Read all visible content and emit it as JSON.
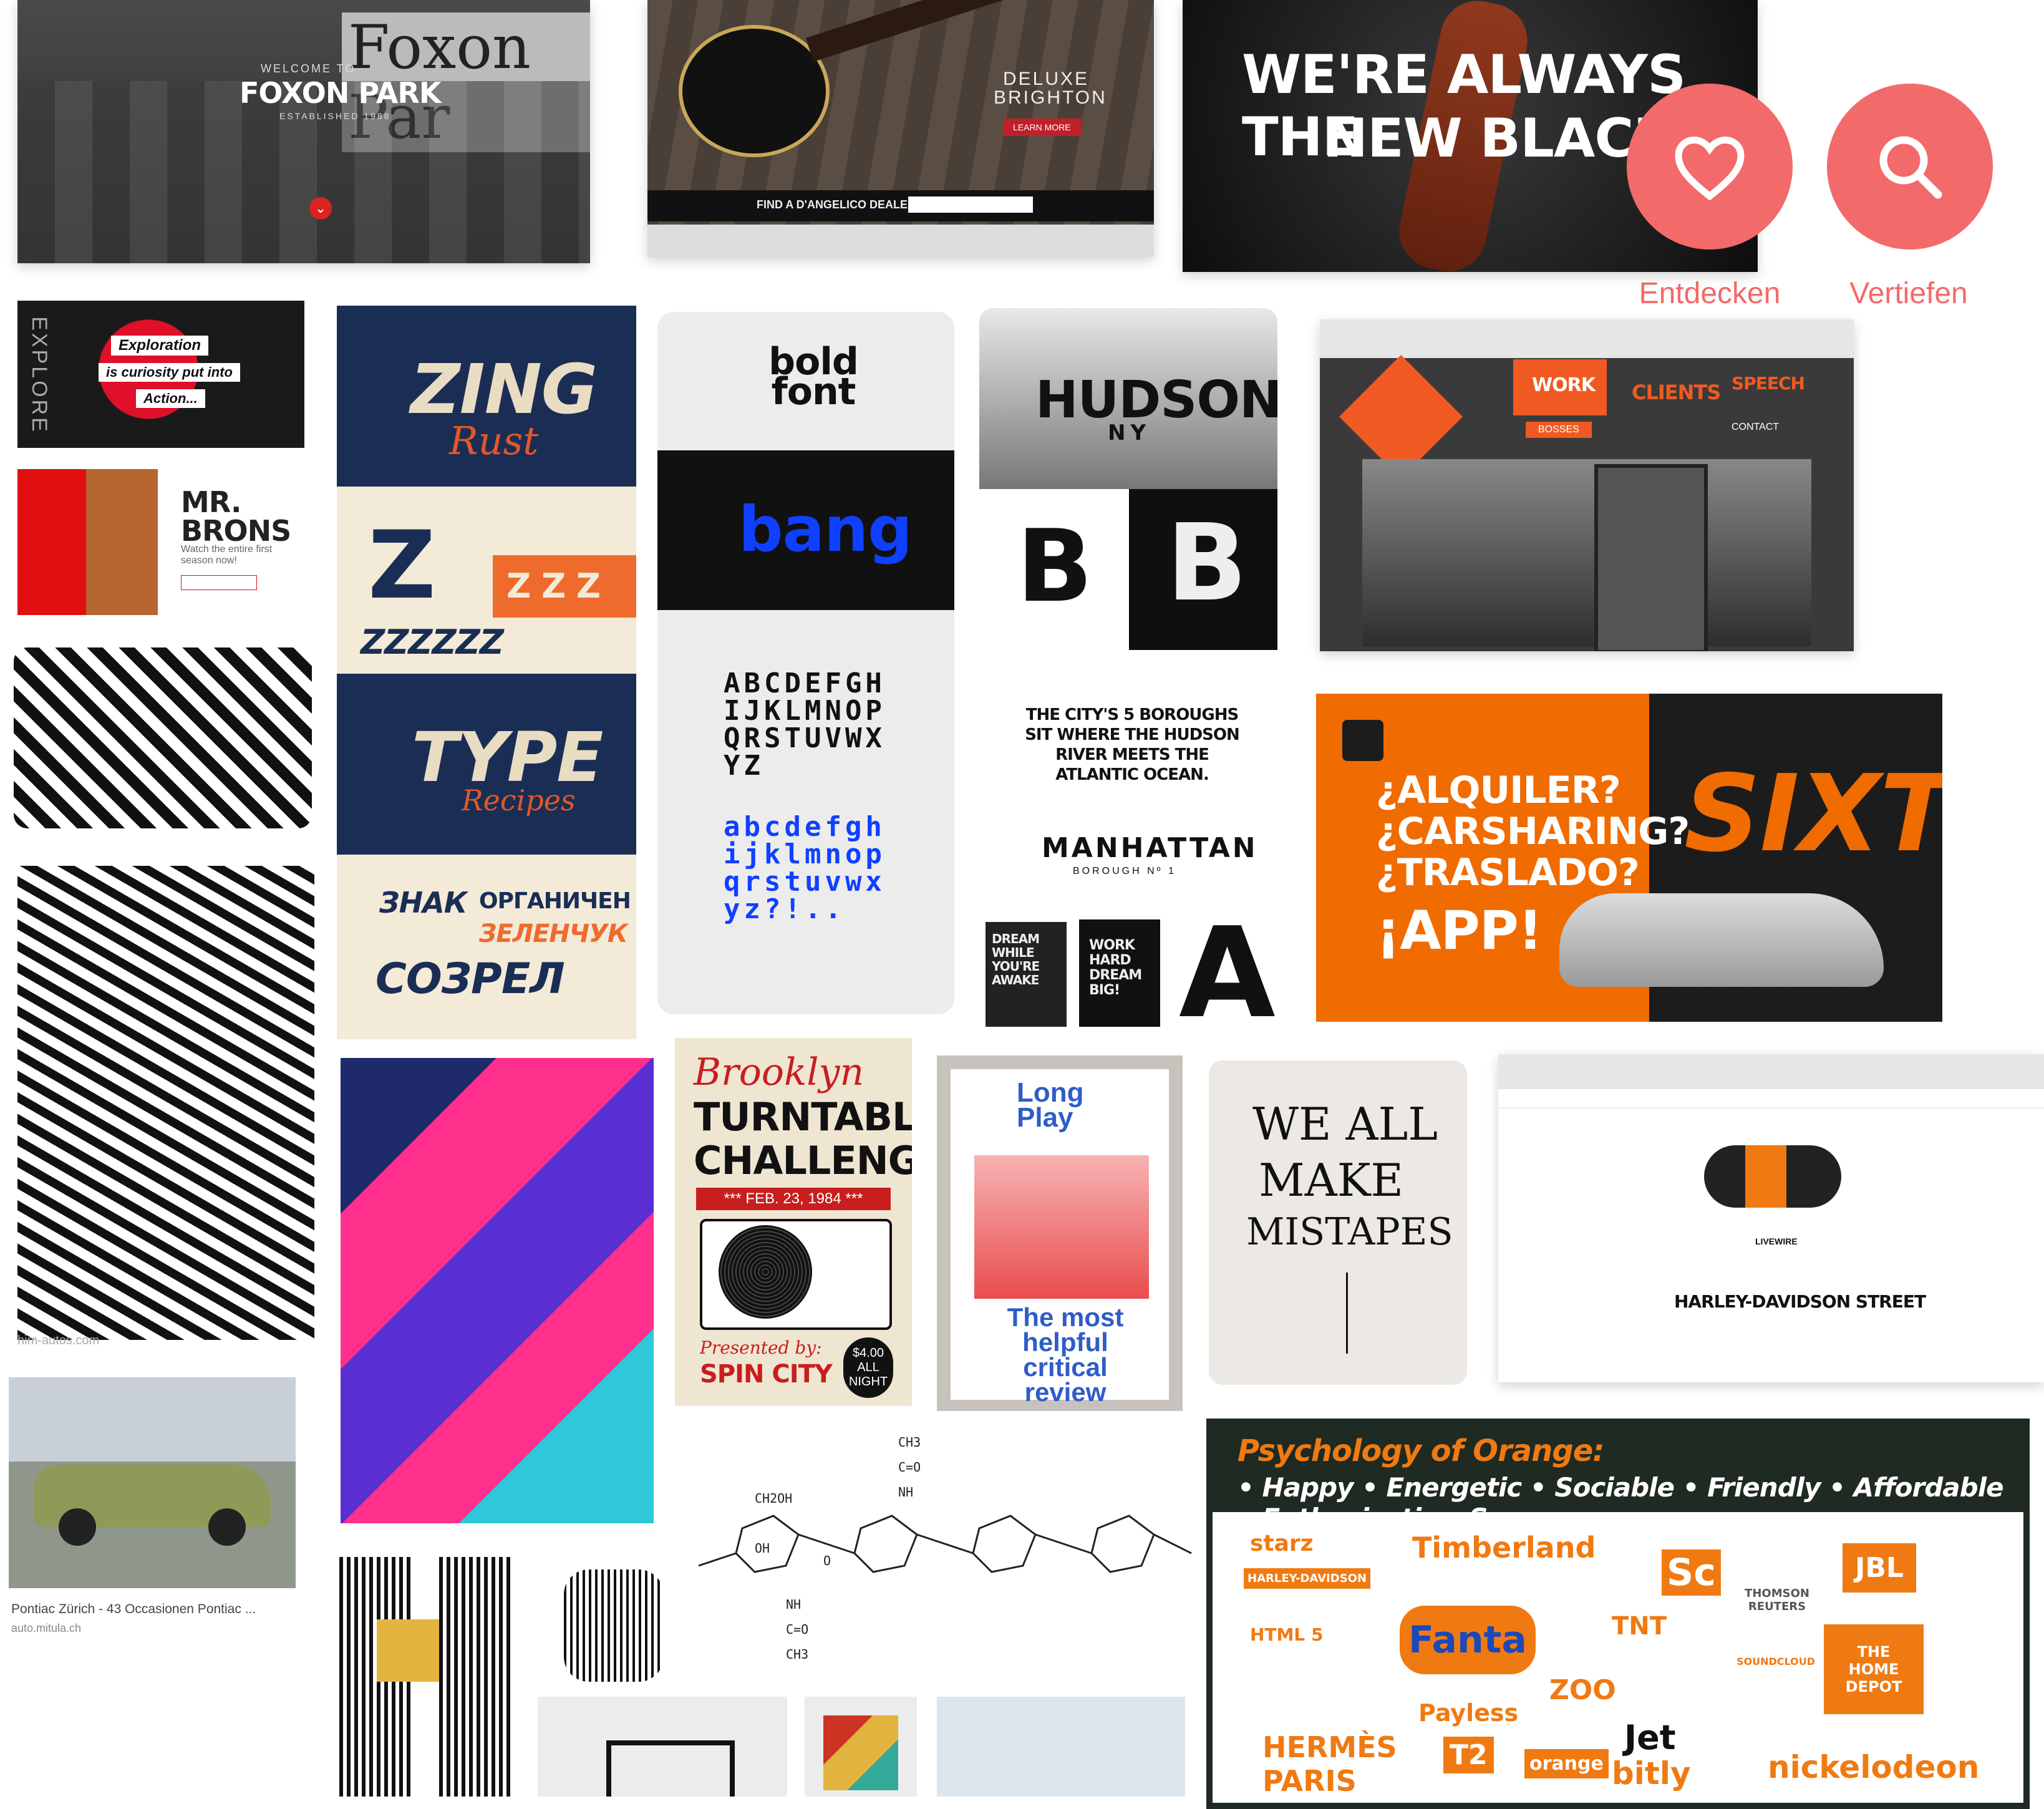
{
  "actions": {
    "discover_label": "Entdecken",
    "deepen_label": "Vertiefen"
  },
  "foxon": {
    "welcome": "WELCOME TO",
    "title": "FOXON PARK",
    "subtitle": "ESTABLISHED 1988",
    "sign": "Foxon Par"
  },
  "guitar": {
    "line1": "DELUXE",
    "line2": "BRIGHTON",
    "cta": "LEARN MORE",
    "dealer": "FIND A D'ANGELICO DEALER"
  },
  "bacon": {
    "line1": "WE'RE ALWAYS THE",
    "line2": "NEW BLACK."
  },
  "explore": {
    "side": "EXPLORE",
    "t1": "Exploration",
    "t2": "is curiosity put into",
    "t3": "Action..."
  },
  "brons": {
    "title": "MR. BRONS",
    "sub": "Watch the entire first season now!"
  },
  "zing": {
    "title": "ZING",
    "sub": "Rust",
    "z": "Z",
    "zzz": "Z Z Z",
    "zzzzzz": "ZZZZZZ",
    "type": "TYPE",
    "recipes": "Recipes",
    "cyr1": "ЗНАК",
    "cyr2": "ОРГАНИЧЕН",
    "cyr3": "ЗЕЛЕНЧУК",
    "cyr4": "СОЗРЕЛ"
  },
  "boldfont": {
    "logo": "bold font",
    "bang": "bang",
    "upper1": "ABCDEFGH",
    "upper2": "IJKLMNOP",
    "upper3": "QRSTUVWX",
    "upper4": "YZ",
    "lower1": "abcdefgh",
    "lower2": "ijklmnop",
    "lower3": "qrstuvwx",
    "lower4": "yz?!.."
  },
  "hudson": {
    "title": "HUDSON",
    "ny": "NY",
    "b": "B",
    "body": "THE CITY'S 5 BOROUGHS SIT WHERE THE HUDSON RIVER MEETS THE ATLANTIC OCEAN.",
    "manhattan": "MANHATTAN",
    "borough": "BOROUGH Nº 1",
    "dream": "DREAM WHILE YOU'RE AWAKE",
    "work": "WORK HARD DREAM BIG!",
    "a": "A"
  },
  "site": {
    "work": "WORK",
    "clients": "CLIENTS",
    "speech": "SPEECH",
    "bosses": "BOSSES",
    "contact": "CONTACT"
  },
  "sixt": {
    "q1": "¿ALQUILER?",
    "q2": "¿CARSHARING?",
    "q3": "¿TRASLADO?",
    "app": "¡APP!",
    "brand": "SIXT"
  },
  "car": {
    "watermark": "him-autos.com",
    "caption": "Pontiac Zürich - 43 Occasionen Pontiac ...",
    "source": "auto.mitula.ch"
  },
  "brooklyn": {
    "l1": "Brooklyn",
    "l2": "TURNTABLE",
    "l3": "CHALLENGE",
    "date": "*** FEB. 23, 1984 ***",
    "by": "Presented by:",
    "spin": "SPIN CITY",
    "price": "$4.00 ALL NIGHT"
  },
  "longplay": {
    "title": "Long Play",
    "review": "The most helpful critical review"
  },
  "mistakes": {
    "l1": "WE ALL",
    "l2": "MAKE",
    "l3": "MISTAPES"
  },
  "harley": {
    "model": "LIVEWIRE",
    "title": "HARLEY-DAVIDSON STREET"
  },
  "chem": {
    "labels": [
      "CH3",
      "C=O",
      "NH",
      "CH2OH",
      "OH",
      "O"
    ]
  },
  "orange": {
    "title": "Psychology of Orange:",
    "traits": "• Happy • Energetic • Sociable • Friendly • Affordable • Enthusiastic • Sunny",
    "logos": [
      "starz",
      "Timberland",
      "HARLEY-DAVIDSON",
      "HTML 5",
      "Fanta",
      "Sc",
      "THOMSON REUTERS",
      "JBL",
      "TNT",
      "ZOO",
      "Payless",
      "HERMÈS PARIS",
      "T2",
      "orange",
      "Jet",
      "bitly",
      "nickelodeon",
      "THE HOME DEPOT",
      "SOUNDCLOUD"
    ]
  },
  "colors": {
    "accent": "#f26a6a",
    "orange": "#f07a12"
  }
}
